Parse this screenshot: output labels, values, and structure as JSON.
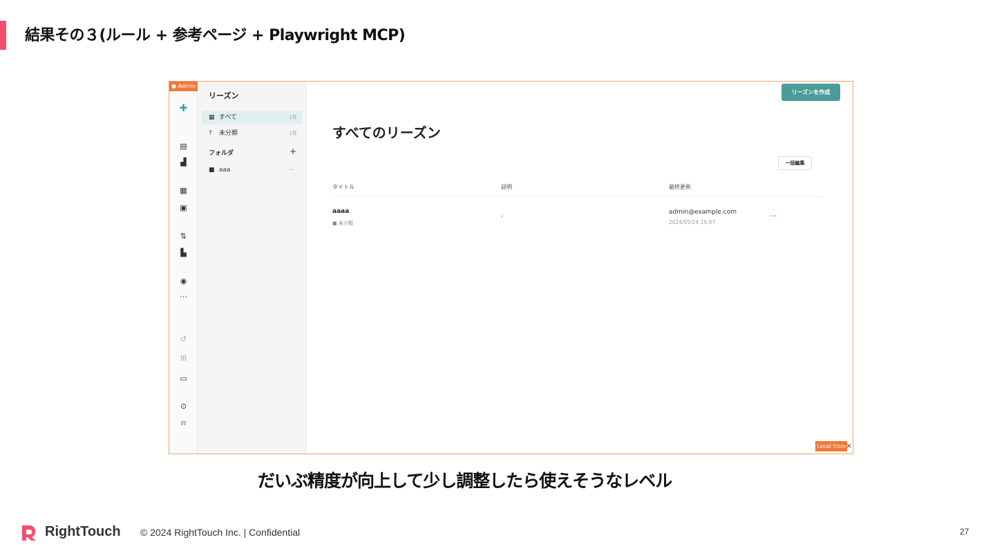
{
  "slide": {
    "title": "結果その３(ルール + 参考ページ + Playwright MCP)",
    "caption": "だいぶ精度が向上して少し調整したら使えそうなレベル",
    "page_number": "27",
    "accent_color": "#f0506e"
  },
  "footer": {
    "brand": "RightTouch",
    "copyright": "© 2024 RightTouch Inc.  |  Confidential"
  },
  "app": {
    "admin_badge": "● Admin",
    "local_badge": "Local from",
    "accent_color": "#4a9c98",
    "rail_icons": [
      "logo-icon",
      "table-icon",
      "chart-icon",
      "grid-icon",
      "layout-icon",
      "flow-icon",
      "document-icon",
      "headset-icon",
      "more-icon",
      "undo-icon",
      "apps-icon",
      "window-icon",
      "help-icon",
      "bell-icon"
    ],
    "panel": {
      "title": "リーズン",
      "items": [
        {
          "icon": "▦",
          "label": "すべて",
          "count": "1件"
        },
        {
          "icon": "?",
          "label": "未分類",
          "count": "1件"
        }
      ],
      "folders_heading": "フォルダ",
      "folders_add": "+",
      "folders": [
        {
          "icon": "■",
          "label": "aaa",
          "more": "···"
        }
      ]
    },
    "main": {
      "create_button": "リーズンを作成",
      "title": "すべてのリーズン",
      "bulk_edit_button": "一括編集",
      "columns": [
        "タイトル",
        "説明",
        "最終更新"
      ],
      "rows": [
        {
          "title": "aaaa",
          "folder": "■ 未分類",
          "description": "-",
          "updated_by": "admin@example.com",
          "updated_at": "2024/05/24 15:07",
          "more": "···"
        }
      ]
    }
  }
}
